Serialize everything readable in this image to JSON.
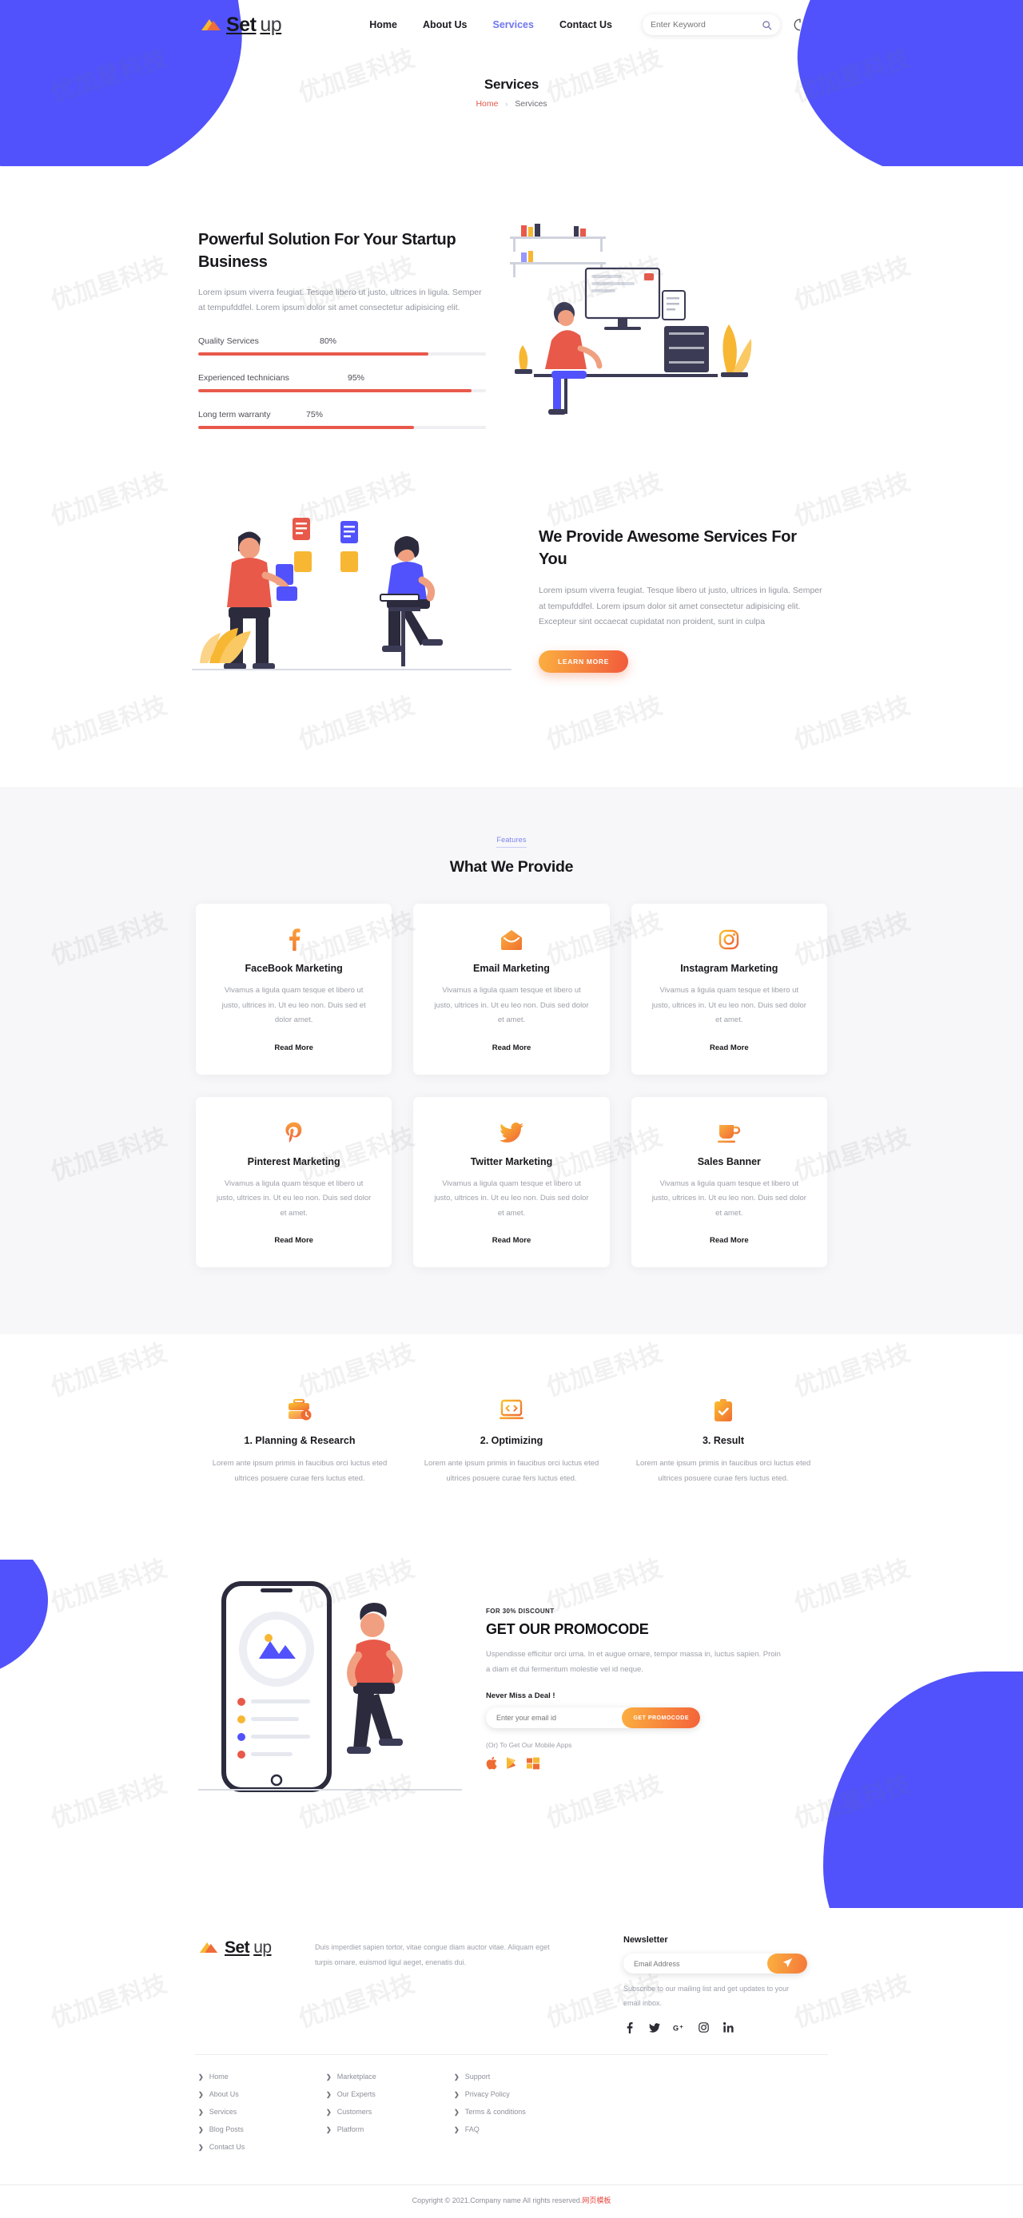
{
  "brand": {
    "name_bold": "Set",
    "name_light": "up"
  },
  "nav": {
    "items": [
      {
        "label": "Home",
        "active": false
      },
      {
        "label": "About Us",
        "active": false
      },
      {
        "label": "Services",
        "active": true
      },
      {
        "label": "Contact Us",
        "active": false
      }
    ],
    "search_placeholder": "Enter Keyword",
    "search_value": ""
  },
  "page_header": {
    "title": "Services",
    "breadcrumb_home": "Home",
    "breadcrumb_sep": "›",
    "breadcrumb_current": "Services"
  },
  "powerful": {
    "title": "Powerful Solution For Your Startup Business",
    "body": "Lorem ipsum viverra feugiat. Tesque libero ut justo, ultrices in ligula. Semper at tempufddfel. Lorem ipsum dolor sit amet consectetur adipisicing elit.",
    "bars": [
      {
        "label": "Quality Services",
        "pct": 80,
        "pct_text": "80%"
      },
      {
        "label": "Experienced technicians",
        "pct": 95,
        "pct_text": "95%"
      },
      {
        "label": "Long term warranty",
        "pct": 75,
        "pct_text": "75%"
      }
    ]
  },
  "awesome": {
    "title": "We Provide Awesome Services For You",
    "body": "Lorem ipsum viverra feugiat. Tesque libero ut justo, ultrices in ligula. Semper at tempufddfel. Lorem ipsum dolor sit amet consectetur adipisicing elit. Excepteur sint occaecat cupidatat non proident, sunt in culpa",
    "button": "LEARN MORE"
  },
  "features": {
    "tag": "Features",
    "heading": "What We Provide",
    "read_more": "Read More",
    "cards": [
      {
        "icon": "facebook-icon",
        "title": "FaceBook Marketing",
        "body": "Vivamus a ligula quam tesque et libero ut justo, ultrices in. Ut eu leo non. Duis sed et dolor amet."
      },
      {
        "icon": "email-icon",
        "title": "Email Marketing",
        "body": "Vivamus a ligula quam tesque et libero ut justo, ultrices in. Ut eu leo non. Duis sed dolor et amet."
      },
      {
        "icon": "instagram-icon",
        "title": "Instagram Marketing",
        "body": "Vivamus a ligula quam tesque et libero ut justo, ultrices in. Ut eu leo non. Duis sed dolor et amet."
      },
      {
        "icon": "pinterest-icon",
        "title": "Pinterest Marketing",
        "body": "Vivamus a ligula quam tesque et libero ut justo, ultrices in. Ut eu leo non. Duis sed dolor et amet."
      },
      {
        "icon": "twitter-icon",
        "title": "Twitter Marketing",
        "body": "Vivamus a ligula quam tesque et libero ut justo, ultrices in. Ut eu leo non. Duis sed dolor et amet."
      },
      {
        "icon": "coffee-cup-icon",
        "title": "Sales Banner",
        "body": "Vivamus a ligula quam tesque et libero ut justo, ultrices in. Ut eu leo non. Duis sed dolor et amet."
      }
    ]
  },
  "steps": [
    {
      "icon": "briefcase-clock-icon",
      "title": "1. Planning & Research",
      "body": "Lorem ante ipsum primis in faucibus orci luctus eted ultrices posuere curae fers luctus eted."
    },
    {
      "icon": "code-window-icon",
      "title": "2. Optimizing",
      "body": "Lorem ante ipsum primis in faucibus orci luctus eted ultrices posuere curae fers luctus eted."
    },
    {
      "icon": "clipboard-check-icon",
      "title": "3. Result",
      "body": "Lorem ante ipsum primis in faucibus orci luctus eted ultrices posuere curae fers luctus eted."
    }
  ],
  "promo": {
    "kicker": "FOR 30% DISCOUNT",
    "title": "GET OUR PROMOCODE",
    "body": "Uspendisse efficitur orci urna. In et augue ornare, tempor massa in, luctus sapien. Proin a diam et dui fermentum molestie vel id neque.",
    "never_miss": "Never Miss a Deal !",
    "email_placeholder": "Enter your email id",
    "email_value": "",
    "button": "GET PROMOCODE",
    "apps_label": "(Or) To Get Our Mobile Apps",
    "stores": [
      "apple-store-icon",
      "google-play-icon",
      "windows-store-icon"
    ]
  },
  "footer": {
    "about": "Duis imperdiet sapien tortor, vitae congue diam auctor vitae. Aliquam eget turpis ornare, euismod ligul aeget, enenatis dui.",
    "newsletter_title": "Newsletter",
    "newsletter_placeholder": "Email Address",
    "newsletter_value": "",
    "newsletter_note": "Subscribe to our mailing list and get updates to your email inbox.",
    "send_icon": "send-plane-icon",
    "socials": [
      "facebook-icon",
      "twitter-icon",
      "google-plus-icon",
      "instagram-icon",
      "linkedin-icon"
    ],
    "columns": [
      {
        "links": [
          "Home",
          "About Us",
          "Services",
          "Blog Posts",
          "Contact Us"
        ]
      },
      {
        "links": [
          "Marketplace",
          "Our Experts",
          "Customers",
          "Platform"
        ]
      },
      {
        "links": [
          "Support",
          "Privacy Policy",
          "Terms & conditions",
          "FAQ"
        ]
      }
    ],
    "chevron": "❯",
    "copyright_text": "Copyright © 2021.Company name All rights reserved.",
    "copyright_tag": "网页模板"
  },
  "watermarks": [
    "优加星科技"
  ],
  "colors": {
    "accent_blue": "#5152fb",
    "accent_orange": "#f4783a",
    "accent_red": "#e8594a",
    "link_purple": "#7b82ee"
  }
}
